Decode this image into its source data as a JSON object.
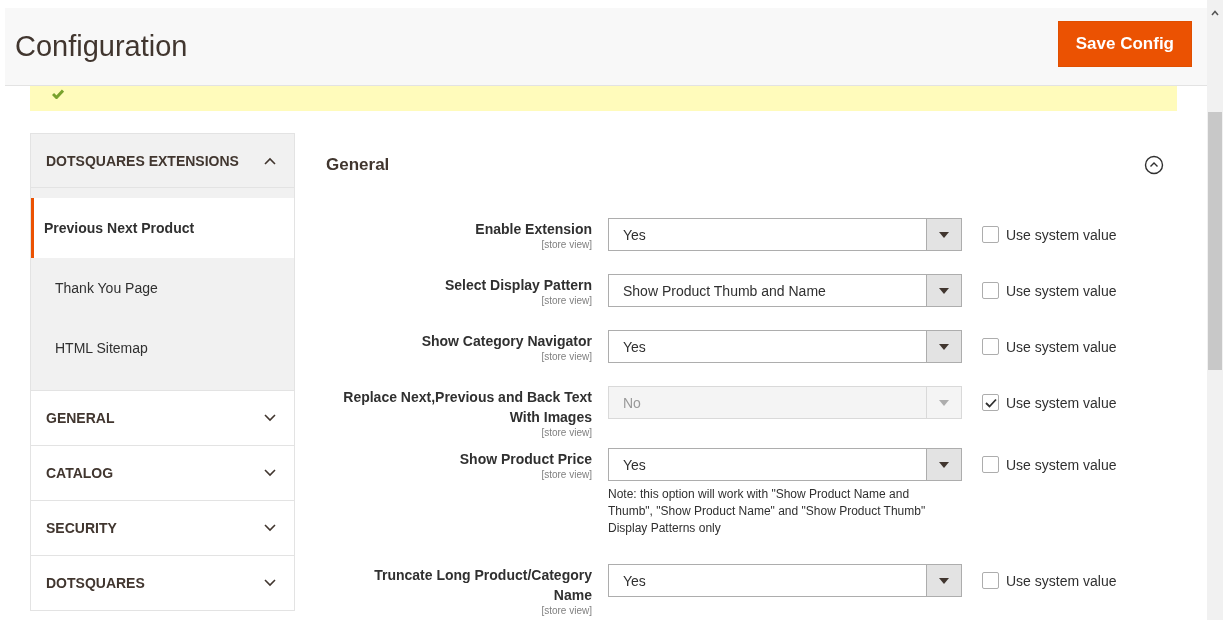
{
  "header": {
    "title": "Configuration",
    "save_button": "Save Config"
  },
  "message": {
    "kind": "success"
  },
  "sidebar": {
    "sections": [
      {
        "title": "DOTSQUARES EXTENSIONS",
        "expanded": true,
        "items": [
          {
            "label": "Previous Next Product",
            "selected": true
          },
          {
            "label": "Thank You Page",
            "selected": false
          },
          {
            "label": "HTML Sitemap",
            "selected": false
          }
        ]
      },
      {
        "title": "GENERAL",
        "expanded": false
      },
      {
        "title": "CATALOG",
        "expanded": false
      },
      {
        "title": "SECURITY",
        "expanded": false
      },
      {
        "title": "DOTSQUARES",
        "expanded": false
      }
    ]
  },
  "group": {
    "title": "General",
    "expanded": true
  },
  "fields": [
    {
      "label": "Enable Extension",
      "scope": "[store view]",
      "value": "Yes",
      "disabled": false,
      "use_system_label": "Use system value",
      "use_system_checked": false
    },
    {
      "label": "Select Display Pattern",
      "scope": "[store view]",
      "value": "Show Product Thumb and Name",
      "disabled": false,
      "use_system_label": "Use system value",
      "use_system_checked": false
    },
    {
      "label": "Show Category Navigator",
      "scope": "[store view]",
      "value": "Yes",
      "disabled": false,
      "use_system_label": "Use system value",
      "use_system_checked": false
    },
    {
      "label": "Replace Next,Previous and Back Text With Images",
      "scope": "[store view]",
      "value": "No",
      "disabled": true,
      "use_system_label": "Use system value",
      "use_system_checked": true
    },
    {
      "label": "Show Product Price",
      "scope": "[store view]",
      "value": "Yes",
      "disabled": false,
      "use_system_label": "Use system value",
      "use_system_checked": false,
      "note": "Note: this option will work with \"Show Product Name and Thumb\", \"Show Product Name\" and \"Show Product Thumb\" Display Patterns only"
    },
    {
      "label": "Truncate Long Product/Category Name",
      "scope": "[store view]",
      "value": "Yes",
      "disabled": false,
      "use_system_label": "Use system value",
      "use_system_checked": false
    }
  ]
}
